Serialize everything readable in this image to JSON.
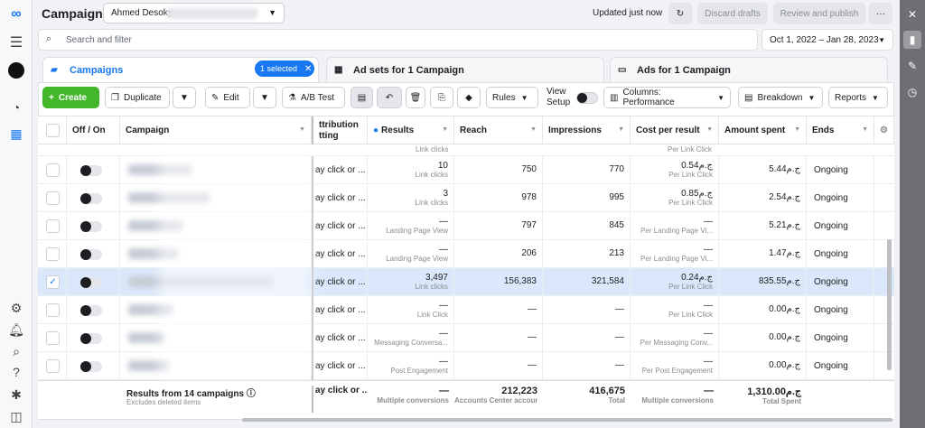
{
  "header": {
    "title": "Campaigns",
    "account_name": "Ahmed Desoky",
    "updated": "Updated just now",
    "discard": "Discard drafts",
    "review": "Review and publish",
    "more": "···"
  },
  "search": {
    "placeholder": "Search and filter"
  },
  "date_range": "Oct 1, 2022 – Jan 28, 2023",
  "tabs": {
    "campaigns": "Campaigns",
    "selected": "1 selected",
    "adsets": "Ad sets for 1 Campaign",
    "ads": "Ads for 1 Campaign"
  },
  "toolbar": {
    "create": "Create",
    "duplicate": "Duplicate",
    "edit": "Edit",
    "abtest": "A/B Test",
    "rules": "Rules",
    "view_setup_1": "View",
    "view_setup_2": "Setup",
    "columns": "Columns: Performance",
    "breakdown": "Breakdown",
    "reports": "Reports"
  },
  "columns": {
    "offon": "Off / On",
    "campaign": "Campaign",
    "attribution_1": "ttribution",
    "attribution_2": "tting",
    "results": "Results",
    "reach": "Reach",
    "impressions": "Impressions",
    "cpr": "Cost per result",
    "spent": "Amount spent",
    "ends": "Ends"
  },
  "partial_row": {
    "results_sub": "Link clicks",
    "cpr_sub": "Per Link Click"
  },
  "rows": [
    {
      "attr": "ay click or ...",
      "results": "10",
      "results_sub": "Link clicks",
      "reach": "750",
      "impressions": "770",
      "cpr": "0.54ج.م",
      "cpr_sub": "Per Link Click",
      "spent": "5.44ج.م",
      "ends": "Ongoing",
      "selected": false
    },
    {
      "attr": "ay click or ...",
      "results": "3",
      "results_sub": "Link clicks",
      "reach": "978",
      "impressions": "995",
      "cpr": "0.85ج.م",
      "cpr_sub": "Per Link Click",
      "spent": "2.54ج.م",
      "ends": "Ongoing",
      "selected": false
    },
    {
      "attr": "ay click or ...",
      "results": "—",
      "results_sub": "Landing Page View",
      "reach": "797",
      "impressions": "845",
      "cpr": "—",
      "cpr_sub": "Per Landing Page Vi...",
      "spent": "5.21ج.م",
      "ends": "Ongoing",
      "selected": false
    },
    {
      "attr": "ay click or ...",
      "results": "—",
      "results_sub": "Landing Page View",
      "reach": "206",
      "impressions": "213",
      "cpr": "—",
      "cpr_sub": "Per Landing Page Vi...",
      "spent": "1.47ج.م",
      "ends": "Ongoing",
      "selected": false
    },
    {
      "attr": "ay click or ...",
      "results": "3,497",
      "results_sub": "Link clicks",
      "reach": "156,383",
      "impressions": "321,584",
      "cpr": "0.24ج.م",
      "cpr_sub": "Per Link Click",
      "spent": "835.55ج.م",
      "ends": "Ongoing",
      "selected": true
    },
    {
      "attr": "ay click or ...",
      "results": "—",
      "results_sub": "Link Click",
      "reach": "—",
      "impressions": "—",
      "cpr": "—",
      "cpr_sub": "Per Link Click",
      "spent": "0.00ج.م",
      "ends": "Ongoing",
      "selected": false
    },
    {
      "attr": "ay click or ...",
      "results": "—",
      "results_sub": "Messaging Conversa...",
      "reach": "—",
      "impressions": "—",
      "cpr": "—",
      "cpr_sub": "Per Messaging Conv...",
      "spent": "0.00ج.م",
      "ends": "Ongoing",
      "selected": false
    },
    {
      "attr": "ay click or ...",
      "results": "—",
      "results_sub": "Post Engagement",
      "reach": "—",
      "impressions": "—",
      "cpr": "—",
      "cpr_sub": "Per Post Engagement",
      "spent": "0.00ج.م",
      "ends": "Ongoing",
      "selected": false
    }
  ],
  "totals": {
    "label": "Results from 14 campaigns",
    "sub": "Excludes deleted items",
    "attr": "ay click or ...",
    "results": "—",
    "results_sub": "Multiple conversions",
    "reach": "212,223",
    "reach_sub": "Accounts Center accoun...",
    "impressions": "416,675",
    "impressions_sub": "Total",
    "cpr": "—",
    "cpr_sub": "Multiple conversions",
    "spent": "1,310.00ج.م",
    "spent_sub": "Total Spent"
  }
}
